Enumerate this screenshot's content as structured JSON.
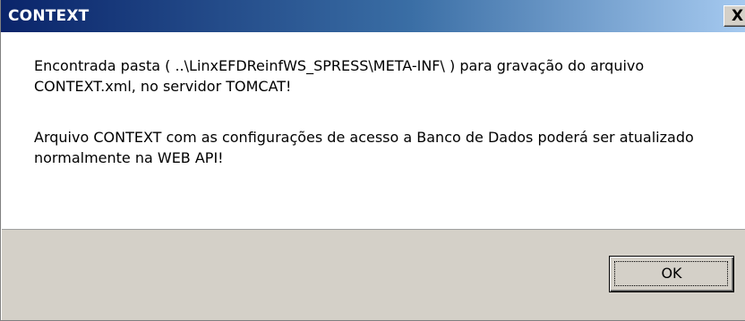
{
  "window": {
    "title": "CONTEXT",
    "close_glyph": "X"
  },
  "message": {
    "line1": "Encontrada pasta ( ..\\LinxEFDReinfWS_SPRESS\\META-INF\\ ) para gravação do arquivo CONTEXT.xml, no servidor TOMCAT!",
    "line2": "Arquivo CONTEXT com as configurações de acesso a Banco de Dados poderá ser atualizado normalmente na WEB API!"
  },
  "buttons": {
    "ok_label": "OK"
  },
  "icons": {
    "close": "close-icon"
  },
  "colors": {
    "title_gradient_start": "#0a246a",
    "title_gradient_end": "#a6caf0",
    "title_text": "#ffffff",
    "button_face": "#d4d0c8",
    "message_background": "#ffffff"
  }
}
